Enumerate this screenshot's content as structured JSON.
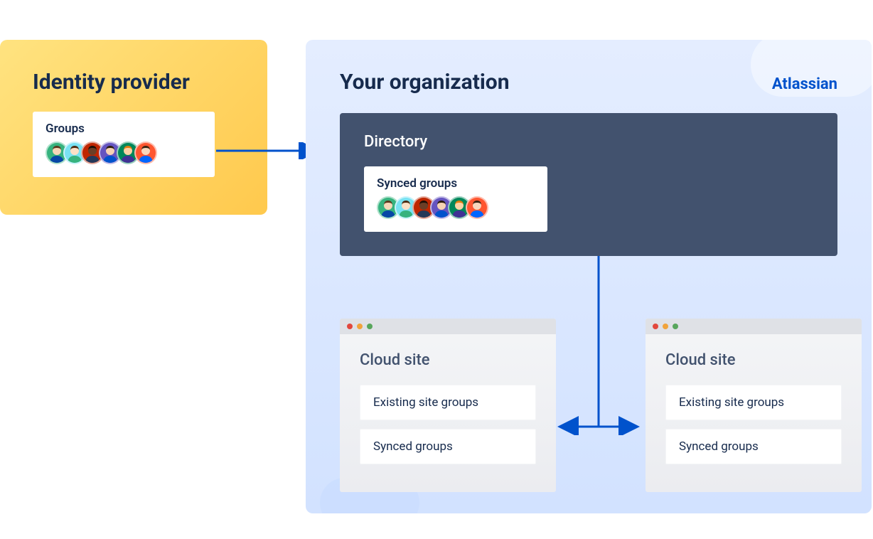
{
  "identity_provider": {
    "title": "Identity provider",
    "groups_label": "Groups"
  },
  "organization": {
    "title": "Your organization",
    "brand": "Atlassian",
    "directory": {
      "title": "Directory",
      "synced_label": "Synced groups"
    },
    "sites": [
      {
        "title": "Cloud site",
        "existing_label": "Existing site groups",
        "synced_label": "Synced groups"
      },
      {
        "title": "Cloud site",
        "existing_label": "Existing site groups",
        "synced_label": "Synced groups"
      }
    ]
  },
  "avatars": [
    {
      "bg": "#36B37E",
      "skin": "#F5D7B8",
      "hair": "#5B3A1E",
      "body": "#0747A6"
    },
    {
      "bg": "#79E2F2",
      "skin": "#FCE0C6",
      "hair": "#4C2A10",
      "body": "#36B37E"
    },
    {
      "bg": "#BF2600",
      "skin": "#6B3E26",
      "hair": "#1C0E06",
      "body": "#253858"
    },
    {
      "bg": "#6554C0",
      "skin": "#F6D2B4",
      "hair": "#2C1B0F",
      "body": "#0052CC"
    },
    {
      "bg": "#00875A",
      "skin": "#FBD3A6",
      "hair": "#E07D11",
      "body": "#403294"
    },
    {
      "bg": "#FF5630",
      "skin": "#F8D6BC",
      "hair": "#3B2311",
      "body": "#0065FF"
    }
  ],
  "colors": {
    "arrow": "#0052CC"
  }
}
